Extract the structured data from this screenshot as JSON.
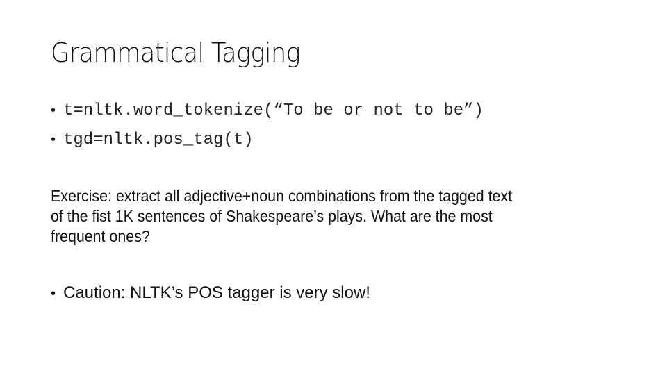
{
  "slide": {
    "title": "Grammatical Tagging",
    "code_bullets": [
      "t=nltk.word_tokenize(“To be or not to be”)",
      "tgd=nltk.pos_tag(t)"
    ],
    "exercise_lines": [
      "Exercise: extract all adjective+noun combinations from the tagged text",
      "of the fist 1K sentences of Shakespeare’s plays. What are the most",
      "frequent ones?"
    ],
    "caution": "Caution: NLTK’s POS tagger is very slow!",
    "bullet_glyph": "•"
  }
}
